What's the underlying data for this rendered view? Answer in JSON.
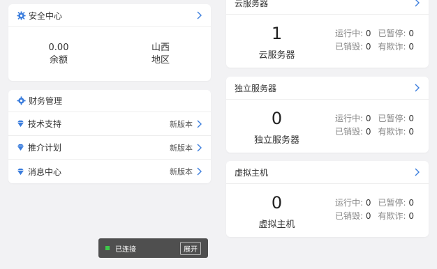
{
  "security": {
    "title": "安全中心",
    "balance_value": "0.00",
    "balance_label": "余额",
    "region_value": "山西",
    "region_label": "地区"
  },
  "finance": {
    "title": "财务管理"
  },
  "menu": [
    {
      "label": "技术支持",
      "badge": "新版本"
    },
    {
      "label": "推介计划",
      "badge": "新版本"
    },
    {
      "label": "消息中心",
      "badge": "新版本"
    }
  ],
  "servers": [
    {
      "title": "云服务器",
      "count": "1",
      "name": "云服务器",
      "running_label": "运行中:",
      "running": "0",
      "paused_label": "已暂停:",
      "paused": "0",
      "destroyed_label": "已销毁:",
      "destroyed": "0",
      "fraud_label": "有欺诈:",
      "fraud": "0"
    },
    {
      "title": "独立服务器",
      "count": "0",
      "name": "独立服务器",
      "running_label": "运行中:",
      "running": "0",
      "paused_label": "已暂停:",
      "paused": "0",
      "destroyed_label": "已销毁:",
      "destroyed": "0",
      "fraud_label": "有欺诈:",
      "fraud": "0"
    },
    {
      "title": "虚拟主机",
      "count": "0",
      "name": "虚拟主机",
      "running_label": "运行中:",
      "running": "0",
      "paused_label": "已暂停:",
      "paused": "0",
      "destroyed_label": "已销毁:",
      "destroyed": "0",
      "fraud_label": "有欺诈:",
      "fraud": "0"
    }
  ],
  "toast": {
    "status": "已连接",
    "button": "展开"
  },
  "colors": {
    "accent": "#3b7ddd",
    "status_green": "#3ec94a"
  }
}
